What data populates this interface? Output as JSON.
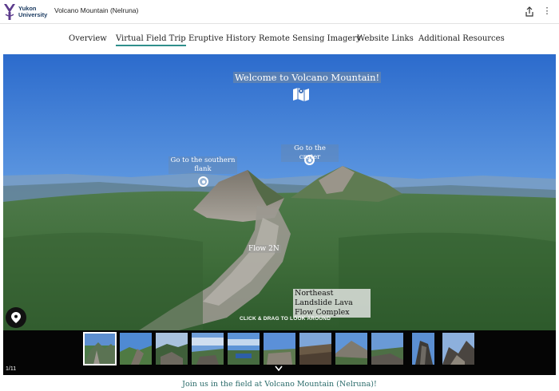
{
  "header": {
    "logo_line1": "Yukon",
    "logo_line2": "University",
    "story_title": "Volcano Mountain (Nelruna)",
    "share_icon": "share-icon",
    "more_icon": "more-options-icon",
    "more_glyph": "⋮"
  },
  "nav": {
    "tabs": [
      {
        "label": "Overview"
      },
      {
        "label": "Virtual Field Trip",
        "active": true
      },
      {
        "label": "Eruptive History"
      },
      {
        "label": "Remote Sensing Imagery"
      },
      {
        "label": "Website Links"
      },
      {
        "label": "Additional Resources"
      }
    ]
  },
  "viewer": {
    "welcome": "Welcome to Volcano Mountain!",
    "hotspots": [
      {
        "label": "Go to the southern flank"
      },
      {
        "label": "Go to the crater"
      }
    ],
    "flow_label": "Flow 2N",
    "landslide_label": "Northeast Landslide Lava Flow Complex",
    "drag_hint": "CLICK & DRAG TO LOOK AROUND"
  },
  "thumbnails": {
    "counter": "1/11",
    "current": 1,
    "total": 11
  },
  "caption": "Join us in the field at Volcano Mountain (Nelruna)!",
  "colors": {
    "accent": "#2f8f8c",
    "caption": "#2a6b6a",
    "brand": "#1d3d63",
    "logo_purple": "#5b3b8c"
  }
}
